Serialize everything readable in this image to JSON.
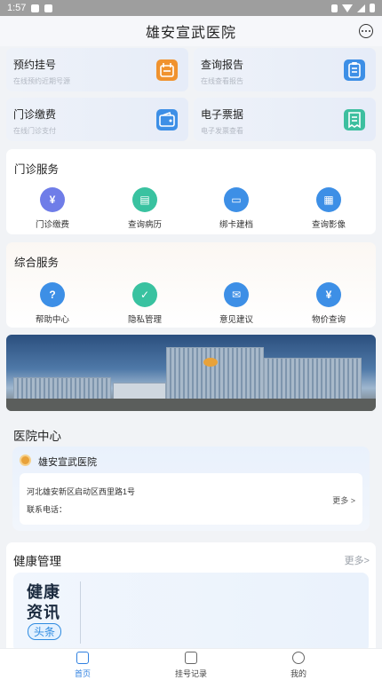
{
  "status_bar": {
    "time": "1:57"
  },
  "header": {
    "title": "雄安宣武医院"
  },
  "quick_actions": [
    {
      "title": "预约挂号",
      "subtitle": "在线预约近期号源",
      "icon": "calendar-icon",
      "color": "#f0922e"
    },
    {
      "title": "查询报告",
      "subtitle": "在线查看报告",
      "icon": "clipboard-icon",
      "color": "#3d8fe6"
    },
    {
      "title": "门诊缴费",
      "subtitle": "在线门诊支付",
      "icon": "wallet-icon",
      "color": "#3d8fe6"
    },
    {
      "title": "电子票据",
      "subtitle": "电子发票查看",
      "icon": "receipt-icon",
      "color": "#3dbf9f"
    }
  ],
  "outpatient": {
    "title": "门诊服务",
    "items": [
      {
        "label": "门诊缴费",
        "icon": "payment-icon",
        "color": "#6f7de8"
      },
      {
        "label": "查询病历",
        "icon": "folder-icon",
        "color": "#39c2a0"
      },
      {
        "label": "绑卡建档",
        "icon": "card-icon",
        "color": "#3d8fe6"
      },
      {
        "label": "查询影像",
        "icon": "film-icon",
        "color": "#3d8fe6"
      }
    ]
  },
  "general": {
    "title": "综合服务",
    "items": [
      {
        "label": "帮助中心",
        "icon": "help-icon",
        "color": "#3d8fe6"
      },
      {
        "label": "隐私管理",
        "icon": "shield-icon",
        "color": "#39c2a0"
      },
      {
        "label": "意见建议",
        "icon": "feedback-icon",
        "color": "#3d8fe6"
      },
      {
        "label": "物价查询",
        "icon": "price-icon",
        "color": "#3d8fe6"
      }
    ]
  },
  "hospital_center": {
    "title": "医院中心",
    "name": "雄安宣武医院",
    "address": "河北雄安新区启动区西里路1号",
    "phone_label": "联系电话：",
    "more": "更多 >"
  },
  "health": {
    "title": "健康管理",
    "more": "更多>",
    "card_line1": "健康",
    "card_line2": "资讯",
    "card_tag": "头条"
  },
  "tabs": [
    {
      "label": "首页",
      "icon": "home-icon",
      "active": true
    },
    {
      "label": "挂号记录",
      "icon": "record-icon",
      "active": false
    },
    {
      "label": "我的",
      "icon": "profile-icon",
      "active": false
    }
  ]
}
